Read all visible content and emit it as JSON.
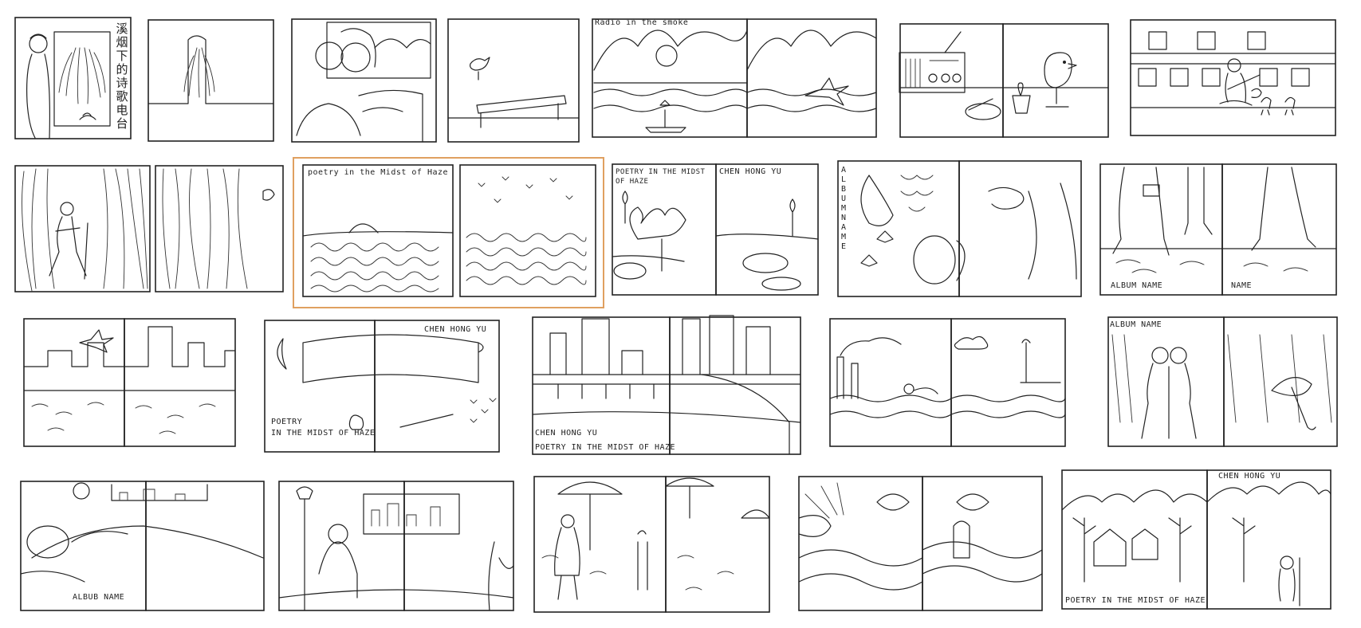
{
  "sheet": {
    "colors": {
      "ink": "#222222",
      "paper": "#ffffff",
      "highlight": "#e0a060"
    },
    "highlighted_spread": "poetry-haze-title"
  },
  "labels": {
    "chinese_title": "溪烟下的诗歌电台",
    "radio_in_the_smoke": "Radio in the smoke",
    "poetry_in_the_midst_of_haze_lower": "poetry in the Midst of Haze",
    "poetry_in_the_midst_of_haze_caps": "POETRY IN THE MIDST OF HAZE",
    "chen_hong_yu": "CHEN HONG YU",
    "album_name_vertical": "ALBUM NAME",
    "album_name": "ALBUM NAME",
    "name": "NAME",
    "poetry_line1": "POETRY",
    "poetry_line2": "IN THE MIDST OF HAZE",
    "chen_hong_yu_caps": "CHEN HONG YU",
    "poetry_haze_caps_2": "POETRY IN THE MIDST OF HAZE",
    "album_name_2": "ALBUM NAME",
    "albub_name": "ALBUB NAME",
    "chen_hong_yu_3": "CHEN HONG YU",
    "poetry_haze_caps_3": "POETRY IN THE MIDST OF HAZE"
  },
  "spreads": [
    "woman-at-window-willow",
    "portrait-and-bird-on-bench",
    "radio-in-the-smoke-mountains",
    "radio-and-bird-figure",
    "guitar-player-train",
    "walker-in-willows",
    "poetry-haze-title",
    "lotus-pond",
    "album-name-faces",
    "walking-feet",
    "city-skyline-dove",
    "scroll-and-moon",
    "train-and-city",
    "smokestack-swimmer",
    "couple-and-umbrella",
    "sleeping-figure",
    "figure-at-window",
    "umbrellas-in-rain",
    "sun-and-waves",
    "mountain-village"
  ]
}
